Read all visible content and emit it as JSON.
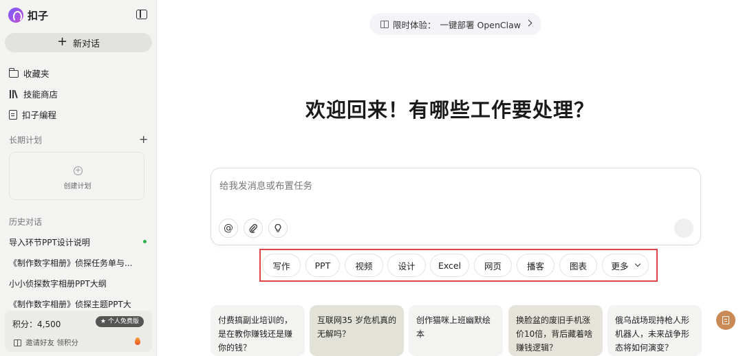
{
  "brand": {
    "name": "扣子"
  },
  "sidebar": {
    "new_chat_label": "新对话",
    "nav": [
      {
        "label": "收藏夹",
        "icon": "folder-icon"
      },
      {
        "label": "技能商店",
        "icon": "books-icon"
      },
      {
        "label": "扣子编程",
        "icon": "code-doc-icon"
      }
    ],
    "long_term_plan": {
      "title": "长期计划",
      "create_label": "创建计划"
    },
    "history": {
      "title": "历史对话",
      "items": [
        "导入环节PPT设计说明",
        "《制作数字相册》侦探任务单与...",
        "小小侦探数字相册PPT大纲",
        "《制作数字相册》侦探主题PPT大"
      ]
    },
    "points": {
      "text": "积分：4,500",
      "badge": "个人免费版",
      "invite": "邀请好友 领积分"
    }
  },
  "main": {
    "promo": {
      "label": "限时体验：",
      "text": "一键部署 OpenClaw"
    },
    "headline": "欢迎回来！有哪些工作要处理？",
    "input": {
      "placeholder": "给我发消息或布置任务",
      "value": ""
    },
    "tools": {
      "mention": "@"
    },
    "chips": [
      "写作",
      "PPT",
      "视频",
      "设计",
      "Excel",
      "网页",
      "播客",
      "图表",
      "更多"
    ],
    "cards": [
      {
        "text": "付费搞副业培训的，是在教你赚钱还是赚你的钱？",
        "bg": "#f3f3f1"
      },
      {
        "text": "互联网35 岁危机真的无解吗？",
        "bg": "#e3e2d8"
      },
      {
        "text": "创作猫咪上班幽默绘本",
        "bg": "#f3f3f1"
      },
      {
        "text": "换脸盆的废旧手机涨价10倍，背后藏着啥赚钱逻辑？",
        "bg": "#e6e4da"
      },
      {
        "text": "俄乌战场现持枪人形机器人，未来战争形态将如何演变？",
        "bg": "#f3f3f1"
      }
    ]
  },
  "colors": {
    "highlight_frame": "#e04343",
    "accent_float": "#c98a55"
  }
}
